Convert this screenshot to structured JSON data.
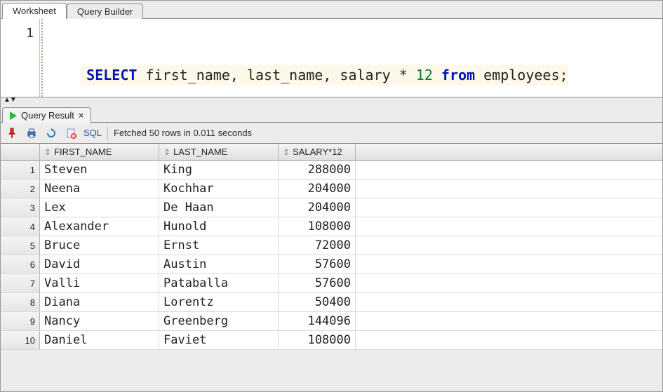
{
  "tabs": {
    "worksheet": "Worksheet",
    "query_builder": "Query Builder"
  },
  "editor": {
    "line_number": "1",
    "tokens": {
      "select": "SELECT",
      "cols": " first_name, last_name, salary * ",
      "twelve": "12",
      "sp": " ",
      "from": "from",
      "tail": " employees;"
    }
  },
  "result_tab": {
    "label": "Query Result"
  },
  "toolbar": {
    "sql_link": "SQL",
    "status": "Fetched 50 rows in 0.011 seconds"
  },
  "columns": {
    "c1": "FIRST_NAME",
    "c2": "LAST_NAME",
    "c3": "SALARY*12"
  },
  "rows": [
    {
      "n": "1",
      "first": "Steven",
      "last": "King",
      "sal": "288000"
    },
    {
      "n": "2",
      "first": "Neena",
      "last": "Kochhar",
      "sal": "204000"
    },
    {
      "n": "3",
      "first": "Lex",
      "last": "De Haan",
      "sal": "204000"
    },
    {
      "n": "4",
      "first": "Alexander",
      "last": "Hunold",
      "sal": "108000"
    },
    {
      "n": "5",
      "first": "Bruce",
      "last": "Ernst",
      "sal": "72000"
    },
    {
      "n": "6",
      "first": "David",
      "last": "Austin",
      "sal": "57600"
    },
    {
      "n": "7",
      "first": "Valli",
      "last": "Pataballa",
      "sal": "57600"
    },
    {
      "n": "8",
      "first": "Diana",
      "last": "Lorentz",
      "sal": "50400"
    },
    {
      "n": "9",
      "first": "Nancy",
      "last": "Greenberg",
      "sal": "144096"
    },
    {
      "n": "10",
      "first": "Daniel",
      "last": "Faviet",
      "sal": "108000"
    }
  ]
}
